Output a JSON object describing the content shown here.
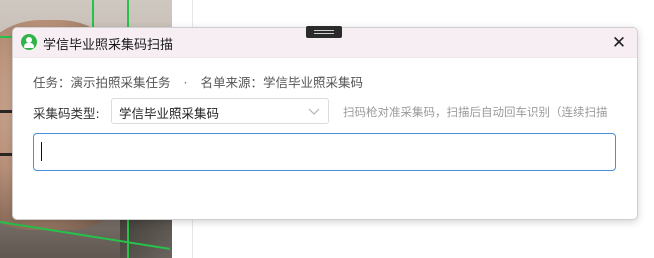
{
  "dialog": {
    "title": "学信毕业照采集码扫描",
    "close_label": "✕"
  },
  "info": {
    "task_label": "任务：演示拍照采集任务",
    "separator": "·",
    "source_label": "名单来源：学信毕业照采集码"
  },
  "code_type": {
    "label": "采集码类型:",
    "selected": "学信毕业照采集码",
    "hint": "扫码枪对准采集码，扫描后自动回车识别（连续扫描"
  },
  "scan_input": {
    "value": "",
    "placeholder": ""
  },
  "colors": {
    "accent": "#4a90d9",
    "titlebar_bg": "#f6eef3",
    "app_icon": "#2fb34a",
    "overlay_line": "#27c24a"
  },
  "icons": {
    "app": "user-badge-icon",
    "close": "close-icon",
    "dropdown": "chevron-down-icon",
    "drag": "drag-handle-icon"
  }
}
